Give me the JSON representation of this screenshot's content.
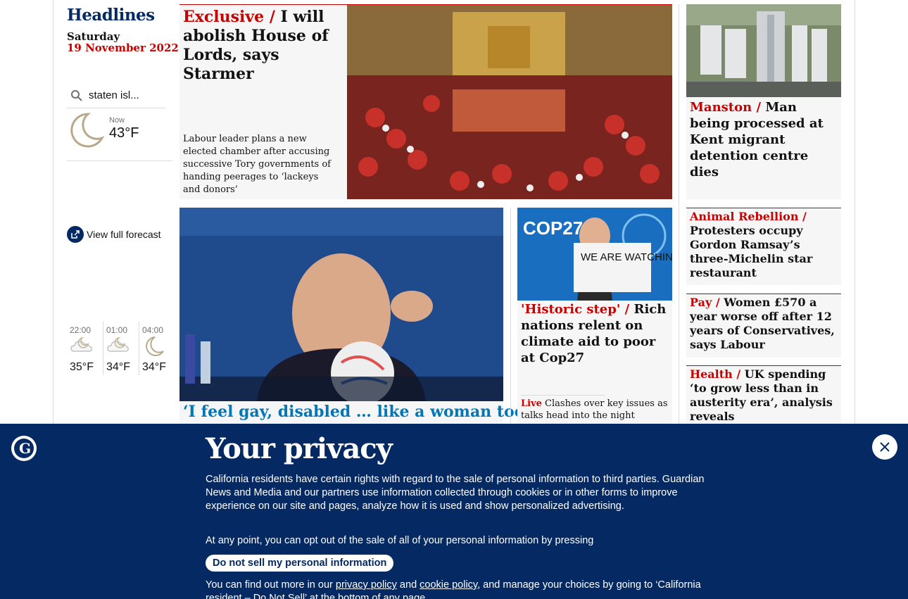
{
  "sidebar": {
    "title": "Headlines",
    "day": "Saturday",
    "date": "19 November 2022",
    "search_value": "staten isl...",
    "now_label": "Now",
    "now_temp": "43°F",
    "forecast": [
      {
        "time": "22:00",
        "temp": "35°F",
        "icon": "cloudy-moon-icon"
      },
      {
        "time": "01:00",
        "temp": "34°F",
        "icon": "cloudy-moon-icon"
      },
      {
        "time": "04:00",
        "temp": "34°F",
        "icon": "moon-icon"
      }
    ],
    "forecast_link": "View full forecast"
  },
  "stories": {
    "lords": {
      "kicker": "Exclusive /",
      "headline": "I will abolish House of Lords, says Starmer",
      "standfirst": "Labour leader plans a new elected chamber after accusing successive Tory governments of handing peerages to ‘lackeys and donors’"
    },
    "manston": {
      "kicker": "Manston /",
      "headline": "Man being processed at Kent migrant detention centre dies"
    },
    "infantino": {
      "headline": "‘I feel gay, disabled … like a woman too’"
    },
    "cop27": {
      "kicker": "'Historic step' /",
      "headline": "Rich nations relent on climate aid to poor at Cop27",
      "live_label": "Live",
      "live_text": "Clashes over key issues as talks head into the night",
      "sign_text": "WE ARE WATCHING",
      "banner_text": "COP27"
    },
    "animal": {
      "kicker": "Animal Rebellion /",
      "headline": "Protesters occupy Gordon Ramsay’s three-Michelin star restaurant"
    },
    "pay": {
      "kicker": "Pay /",
      "headline": "Women £570 a year worse off after 12 years of Conservatives, says Labour"
    },
    "health": {
      "kicker": "Health /",
      "headline": "UK spending ‘to grow less than in austerity era’, analysis reveals"
    }
  },
  "privacy": {
    "title": "Your privacy",
    "body1": "California residents have certain rights with regard to the sale of personal information to third parties. Guardian News and Media and our partners use information collected through cookies or in other forms to improve experience on our site and pages, analyze how it is used and show personalized advertising.",
    "body2": "At any point, you can opt out of the sale of all of your personal information by pressing",
    "button": "Do not sell my personal information",
    "body3_pre": "You can find out more in our ",
    "privacy_link": "privacy policy",
    "body3_and": " and ",
    "cookie_link": "cookie policy",
    "body3_post": ", and manage your choices by going to ‘California resident – Do Not Sell’ at the bottom of any page."
  },
  "colors": {
    "brand": "#052962",
    "news_red": "#c70000",
    "card_bg": "#f6f6f6"
  }
}
